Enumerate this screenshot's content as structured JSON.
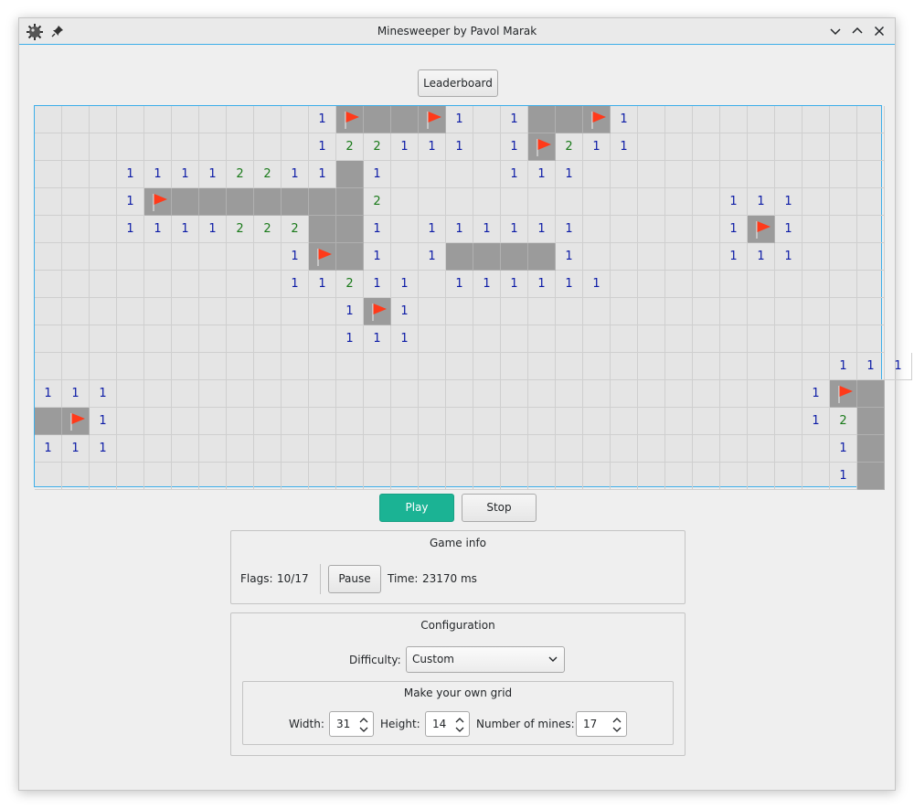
{
  "window": {
    "title": "Minesweeper by Pavol Marak"
  },
  "toolbar": {
    "leaderboard_label": "Leaderboard"
  },
  "grid": {
    "width": 31,
    "height": 14,
    "rows": [
      "..........1FCCF1.1CCF1.........",
      "..........122111.1F211.........",
      "...11112211C1....111...........",
      "...1FCCCCCCC2............111...",
      "...1111222CC1.111111.....1F1...",
      ".........1FC1.1CCCC1.....111...",
      ".........11211.111111..........",
      "...........1F1.................",
      "...........111.................",
      ".............................111",
      "111.........................1FC",
      "CF1.........................12C",
      "111..........................1C",
      ".............................1C"
    ]
  },
  "controls": {
    "play_label": "Play",
    "stop_label": "Stop"
  },
  "game_info": {
    "title": "Game info",
    "flags_label": "Flags:",
    "flags_value": "10/17",
    "pause_label": "Pause",
    "time_label": "Time:",
    "time_value": "23170 ms"
  },
  "config": {
    "title": "Configuration",
    "difficulty_label": "Difficulty:",
    "difficulty_value": "Custom",
    "custom_title": "Make your own grid",
    "width_label": "Width:",
    "width_value": "31",
    "height_label": "Height:",
    "height_value": "14",
    "mines_label": "Number of mines:",
    "mines_value": "17"
  },
  "colors": {
    "accent": "#1bb394",
    "number_one": "#0b1aa6",
    "number_two": "#1a7a1a",
    "flag": "#ff3a1a",
    "closed_cell": "#9b9b9b"
  },
  "icons": [
    "mine-app-icon",
    "pin-icon",
    "minimize-icon",
    "maximize-icon",
    "close-icon",
    "flag-icon",
    "chevron-down-icon",
    "spin-arrows-icon"
  ]
}
